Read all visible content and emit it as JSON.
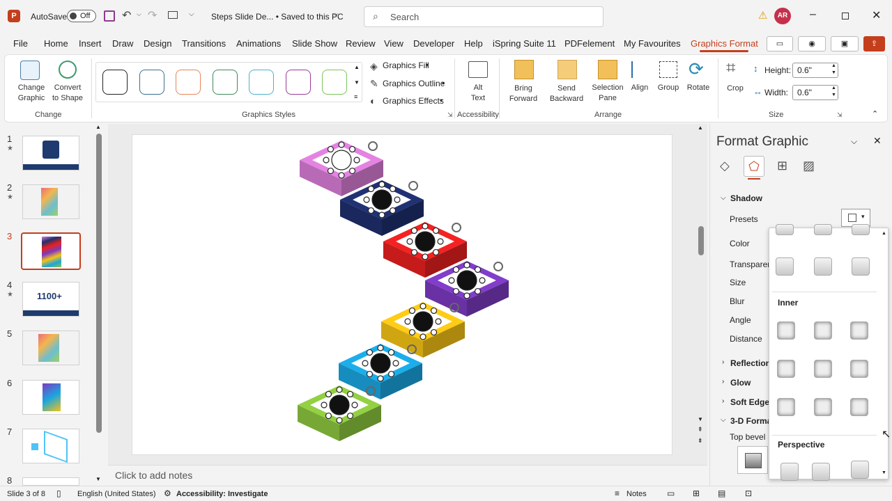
{
  "titlebar": {
    "autosave_label": "AutoSave",
    "autosave_state": "Off",
    "doc_title": "Steps Slide De... • Saved to this PC",
    "search_placeholder": "Search",
    "avatar_initials": "AR"
  },
  "menu": {
    "items": [
      "File",
      "Home",
      "Insert",
      "Draw",
      "Design",
      "Transitions",
      "Animations",
      "Slide Show",
      "Review",
      "View",
      "Developer",
      "Help",
      "iSpring Suite 11",
      "PDFelement",
      "My Favourites",
      "Graphics Format"
    ],
    "active": "Graphics Format"
  },
  "ribbon": {
    "change_graphic": "Change Graphic",
    "convert_to_shape": "Convert to Shape",
    "group_change": "Change",
    "group_graphics_styles": "Graphics Styles",
    "graphics_fill": "Graphics Fill",
    "graphics_outline": "Graphics Outline",
    "graphics_effects": "Graphics Effects",
    "alt_text": "Alt Text",
    "group_accessibility": "Accessibility",
    "bring_forward": "Bring Forward",
    "send_backward": "Send Backward",
    "selection_pane": "Selection Pane",
    "align": "Align",
    "group": "Group",
    "rotate": "Rotate",
    "group_arrange": "Arrange",
    "crop": "Crop",
    "height_label": "Height:",
    "height_value": "0.6\"",
    "width_label": "Width:",
    "width_value": "0.6\"",
    "group_size": "Size",
    "style_colors": [
      "#222222",
      "#3a6f8f",
      "#e8845a",
      "#3f8a5a",
      "#4ab2c8",
      "#9a3a9a",
      "#7cc35a"
    ]
  },
  "slides": {
    "numbers": [
      "1",
      "2",
      "3",
      "4",
      "5",
      "6",
      "7",
      "8"
    ],
    "thumb4_text": "1100+",
    "current_index": 3
  },
  "canvas": {
    "notes_placeholder": "Click to add notes",
    "step_colors": [
      "#d97dd6",
      "#1e2f6e",
      "#e82020",
      "#7c3ac0",
      "#f5c215",
      "#1aa6e0",
      "#8cc63f"
    ]
  },
  "format_pane": {
    "title": "Format Graphic",
    "shadow": "Shadow",
    "presets": "Presets",
    "color": "Color",
    "transparency": "Transparen",
    "size": "Size",
    "blur": "Blur",
    "angle": "Angle",
    "distance": "Distance",
    "reflection": "Reflection",
    "glow": "Glow",
    "soft_edges": "Soft Edges",
    "three_d_format": "3-D Forma",
    "top_bevel": "Top bevel",
    "dropdown_inner": "Inner",
    "dropdown_perspective": "Perspective"
  },
  "status": {
    "slide_info": "Slide 3 of 8",
    "language": "English (United States)",
    "accessibility": "Accessibility: Investigate",
    "notes": "Notes"
  }
}
